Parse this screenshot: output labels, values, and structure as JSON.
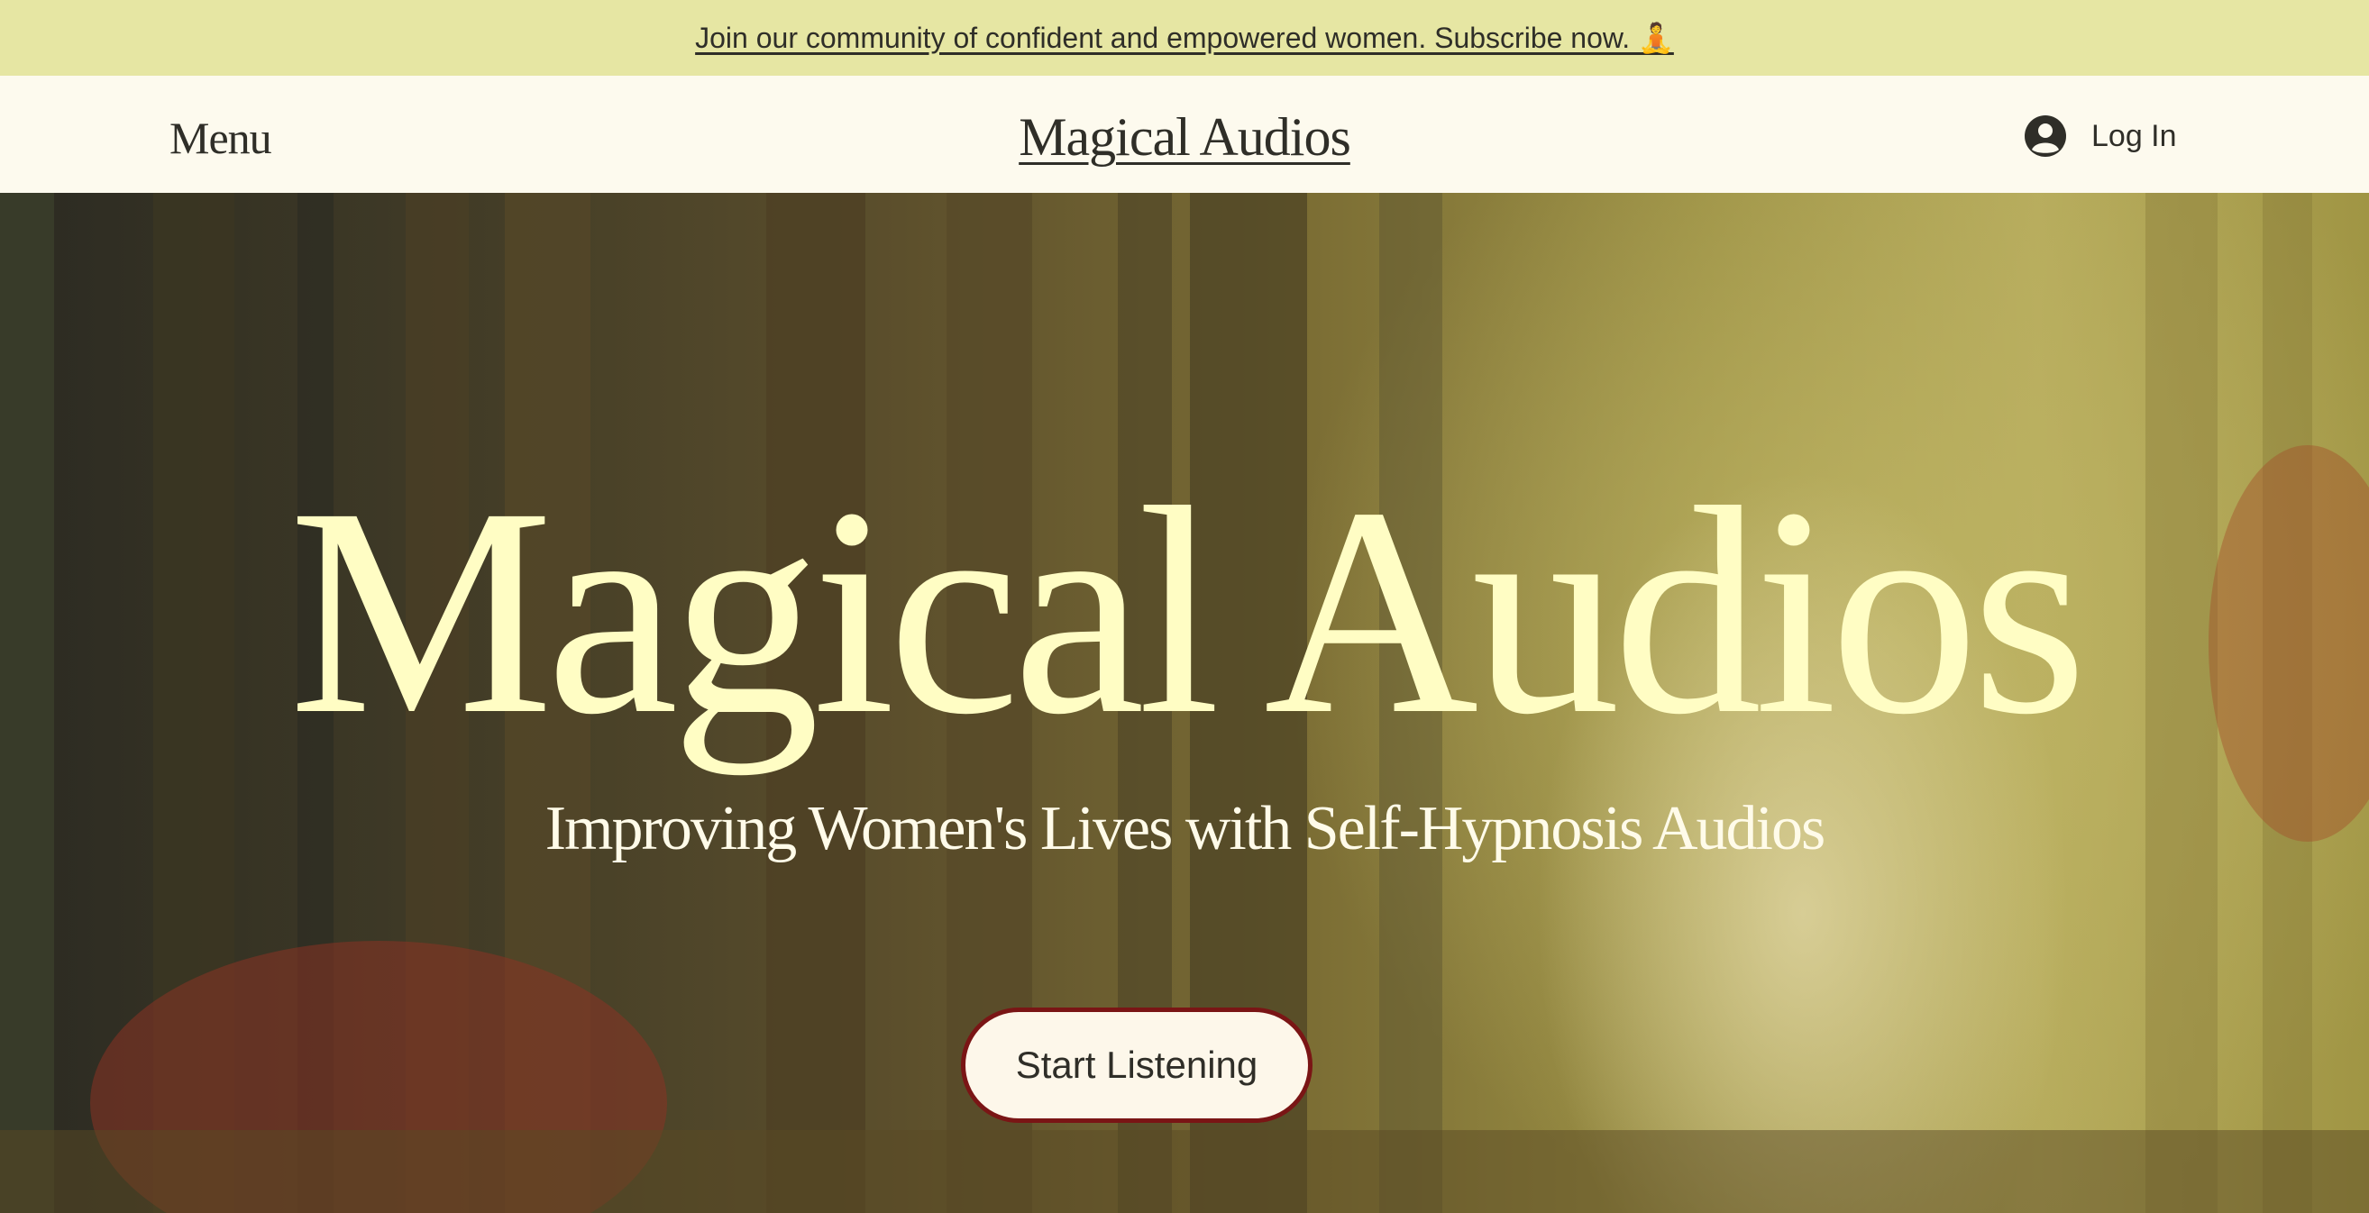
{
  "announcement": {
    "text": "Join our community of confident and empowered women. Subscribe now. 🧘"
  },
  "header": {
    "menu_label": "Menu",
    "logo_text": "Magical Audios",
    "login_label": "Log In",
    "login_icon": "user-avatar-icon"
  },
  "hero": {
    "title": "Magical Audios",
    "subtitle": "Improving Women's Lives with Self-Hypnosis Audios",
    "cta_label": "Start Listening",
    "background": "misty-forest-photo"
  },
  "colors": {
    "announcement_bg": "#e6e6a3",
    "header_bg": "#fdfaee",
    "text_dark": "#2f2e28",
    "hero_title": "#fffdc4",
    "cta_border": "#7a1515",
    "cta_bg": "#fdf7ea"
  }
}
